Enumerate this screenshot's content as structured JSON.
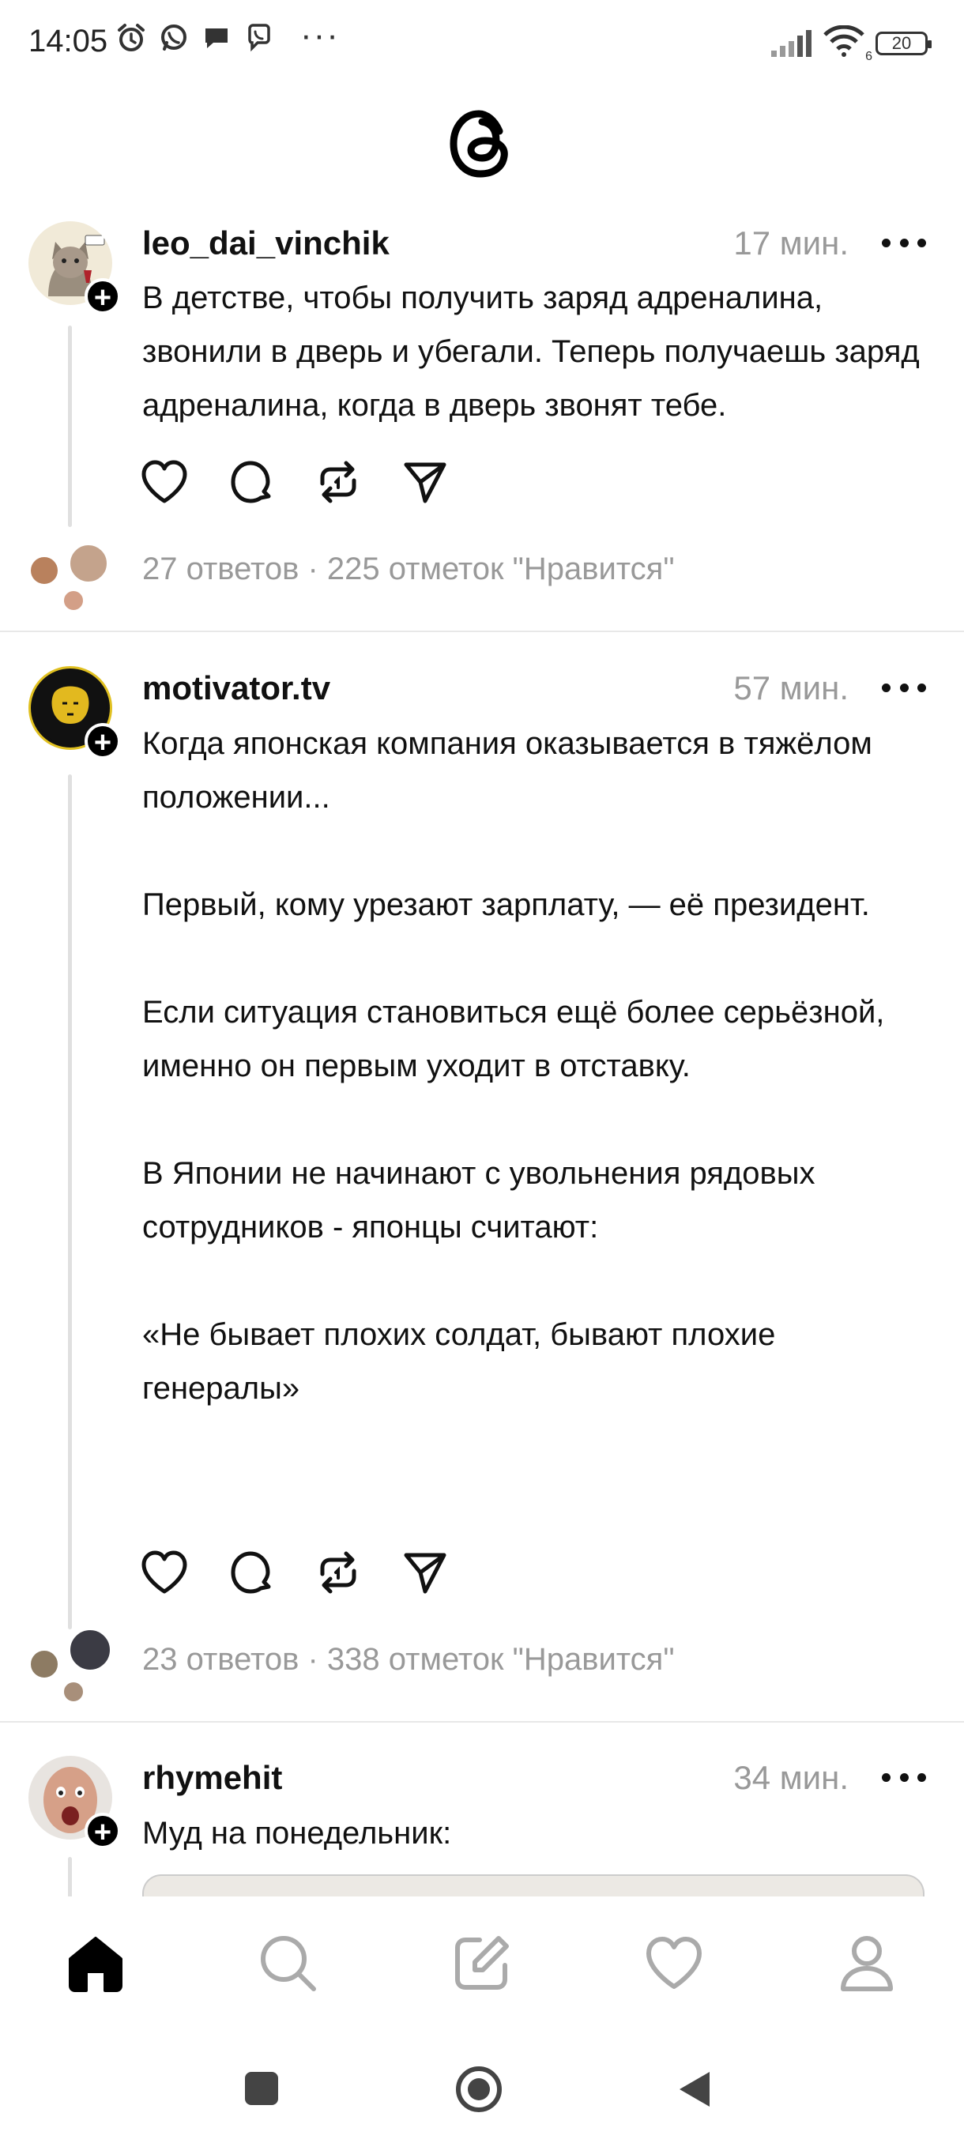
{
  "status_bar": {
    "time": "14:05",
    "left_icons": [
      "alarm-icon",
      "whatsapp-icon",
      "chat-bubble-icon",
      "viber-icon"
    ],
    "more_notifications": "···",
    "signal": "signal-icon",
    "wifi": "wifi-icon",
    "wifi_badge": "6",
    "battery": "20"
  },
  "app": {
    "logo": "threads-logo"
  },
  "posts": [
    {
      "username": "leo_dai_vinchik",
      "time": "17 мин.",
      "text": "В детстве, чтобы получить заряд адреналина, звонили в дверь и убегали. Теперь получаешь заряд адреналина, когда в дверь звонят тебе.",
      "stats": "27 ответов · 225 отметок \"Нравится\""
    },
    {
      "username": "motivator.tv",
      "time": "57 мин.",
      "text": "Когда японская компания оказывается в тяжёлом положении...\n\nПервый, кому урезают зарплату, — её президент.\n\nЕсли ситуация становиться ещё более серьёзной, именно он первым уходит в отставку.\n\nВ Японии не начинают с увольнения рядовых сотрудников - японцы считают:\n\n«Не бывает плохих солдат, бывают плохие генералы»",
      "stats": "23 ответов · 338 отметок \"Нравится\""
    },
    {
      "username": "rhymehit",
      "time": "34 мин.",
      "text": "Муд на понедельник:"
    }
  ],
  "actions": [
    "heart-icon",
    "comment-icon",
    "repost-icon",
    "share-icon"
  ],
  "bottom_nav": [
    "home-icon",
    "search-icon",
    "compose-icon",
    "activity-icon",
    "profile-icon"
  ],
  "system_nav": [
    "recents-button",
    "home-button",
    "back-button"
  ],
  "colors": {
    "text": "#111111",
    "muted": "#999999",
    "divider": "#e8e8e8",
    "thread_line": "#e0e0e0"
  }
}
